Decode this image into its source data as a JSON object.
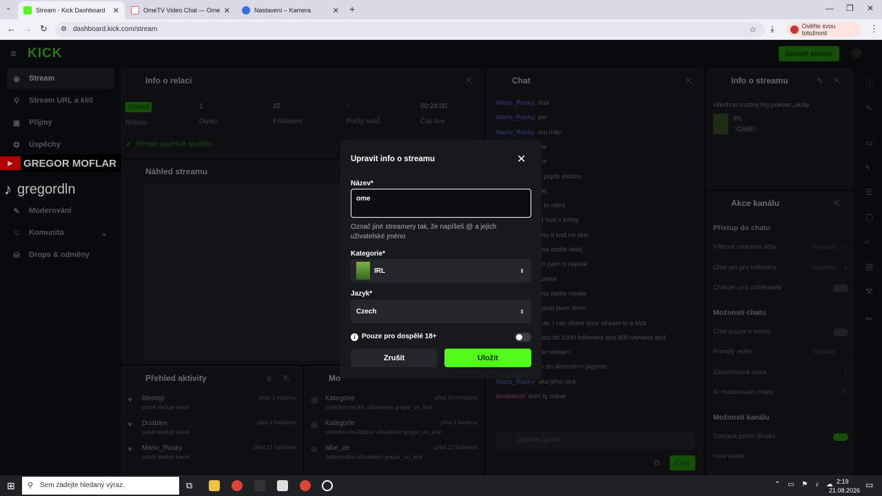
{
  "browser": {
    "tabs": [
      {
        "label": "Stream - Kick Dashboard",
        "active": true
      },
      {
        "label": "OmeTV Video Chat — Ome",
        "active": false
      },
      {
        "label": "Nastavení – Kamera",
        "active": false
      }
    ],
    "url": "dashboard.kick.com/stream",
    "profile_label": "Ověřte svou totožnost"
  },
  "kick": {
    "logo": "KICK",
    "go_live_button": "Spustit stream",
    "sidebar": [
      "Stream",
      "Stream URL a klíč",
      "Příjmy",
      "Úspěchy",
      "Moderování",
      "Komunita",
      "Drops & odměny"
    ],
    "overlay_name_youtube": "GREGOR MOFLAR",
    "overlay_name_tiktok": "gregordln",
    "session": {
      "title": "Info o relaci",
      "status_badge": "ZDRAVÉ",
      "status_label": "Relace",
      "stats": [
        {
          "value": "1",
          "label": "Diváci"
        },
        {
          "value": "15",
          "label": "Followers"
        },
        {
          "value": "-",
          "label": "Počty subů"
        },
        {
          "value": "00:24:00",
          "label": "Čas live"
        }
      ],
      "success_msg": "Stream úspěšně spuštěn."
    },
    "preview_title": "Náhled streamu",
    "activity": {
      "title": "Přehled aktivity",
      "items": [
        {
          "user": "bleetop",
          "desc": "právě sleduje kanál",
          "time": "před 1 hodinou"
        },
        {
          "user": "Doables",
          "desc": "právě sleduje kanál",
          "time": "před 2 hodinami"
        },
        {
          "user": "Mario_Rasky",
          "desc": "právě sleduje kanál",
          "time": "před 13 hodinami"
        }
      ]
    },
    "mod": {
      "title": "Mo",
      "items": [
        {
          "title": "Kategorie",
          "desc": "změněno na IRL uživatelem gregor_on_kick",
          "time": "před 23 minutami"
        },
        {
          "title": "Kategorie",
          "desc": "změněno na Roblox uživatelem gregor_on_kick",
          "time": "před 1 hodinou"
        },
        {
          "title": "albe_ze",
          "desc": "zabanováno uživatelem gregor_on_kick",
          "time": "před 22 hodinami"
        }
      ]
    },
    "chat": {
      "title": "Chat",
      "messages": [
        {
          "user": "Mario_Rasky",
          "text": ": dua"
        },
        {
          "user": "Mario_Rasky",
          "text": ": joo"
        },
        {
          "user": "Mario_Rasky",
          "text": ": ma mikr"
        },
        {
          "user": "",
          "text": "nike"
        },
        {
          "user": "",
          "text": "nice"
        },
        {
          "user": "",
          "text": "an pujde stebou"
        },
        {
          "user": "",
          "text": "ekej"
        },
        {
          "user": "",
          "text": "nu to rekni"
        },
        {
          "user": "",
          "text": "nej bud v lobby"
        },
        {
          "user": "",
          "text": "eknu ti kod na skin"
        },
        {
          "user": "",
          "text": "di na battle delej"
        },
        {
          "user": "",
          "text": "kod jsem ti napsal"
        },
        {
          "user": "",
          "text": "moreee"
        },
        {
          "user": "",
          "text": "di na battle royale"
        },
        {
          "user": "",
          "text": "napsal jsem dmm"
        },
        {
          "user": "",
          "text": "omie, i can share your stream in a kick"
        },
        {
          "user": "",
          "text": "p you hit 1000 followers and 800 viewers and"
        },
        {
          "user": "",
          "text": "l per stream,"
        },
        {
          "user": "",
          "text": "me on discord>> jaypron"
        },
        {
          "user": "Mario_Rasky",
          "text": ": uka jeho nick"
        },
        {
          "user": "tomaskrol",
          "text": ": dam ty odber"
        }
      ],
      "input_placeholder": "Odeslat zprávu",
      "send_button": "Chat"
    },
    "stream_info": {
      "title": "Info o streamu",
      "stream_title": "všechno možný,hry,pokeec,ukoly",
      "category": "IRL",
      "language": "Czech"
    },
    "channel_actions": {
      "title": "Akce kanálu",
      "sections": [
        {
          "heading": "Přístup do chatu",
          "rows": [
            {
              "label": "Věkové omezení účtu",
              "value": "Vypnuto"
            },
            {
              "label": "Chat jen pro followery",
              "value": "Vypnuto"
            },
            {
              "label": "Chat jen pro odběratele",
              "value": ""
            }
          ]
        },
        {
          "heading": "Možnosti chatu",
          "rows": [
            {
              "label": "Chat pouze s emoty",
              "value": ""
            },
            {
              "label": "Pomalý režim",
              "value": "Vypnuto"
            },
            {
              "label": "Zabanovaná slova",
              "value": ""
            },
            {
              "label": "AI moderování chatu",
              "value": ""
            }
          ]
        },
        {
          "heading": "Možnosti kanálu",
          "rows": [
            {
              "label": "Zobrazit počet diváků",
              "value": ""
            },
            {
              "label": "Host kanál",
              "value": ""
            }
          ]
        }
      ]
    }
  },
  "modal": {
    "title": "Upravit info o streamu",
    "name_label": "Název*",
    "name_value": "ome",
    "hint": "Označ jiné streamery tak, že napíšeš @ a jejich uživatelské jméno",
    "category_label": "Kategorie*",
    "category_value": "IRL",
    "language_label": "Jazyk*",
    "language_value": "Czech",
    "adult_label": "Pouze pro dospělé 18+",
    "cancel_button": "Zrušit",
    "save_button": "Uložit"
  },
  "taskbar": {
    "search_placeholder": "Sem zadejte hledaný výraz.",
    "time": "2:19",
    "date": "21.08.2026"
  },
  "colors": {
    "kick_green": "#53fc18",
    "modal_bg": "#18191b",
    "accent_purple": "#4a4ea8"
  }
}
